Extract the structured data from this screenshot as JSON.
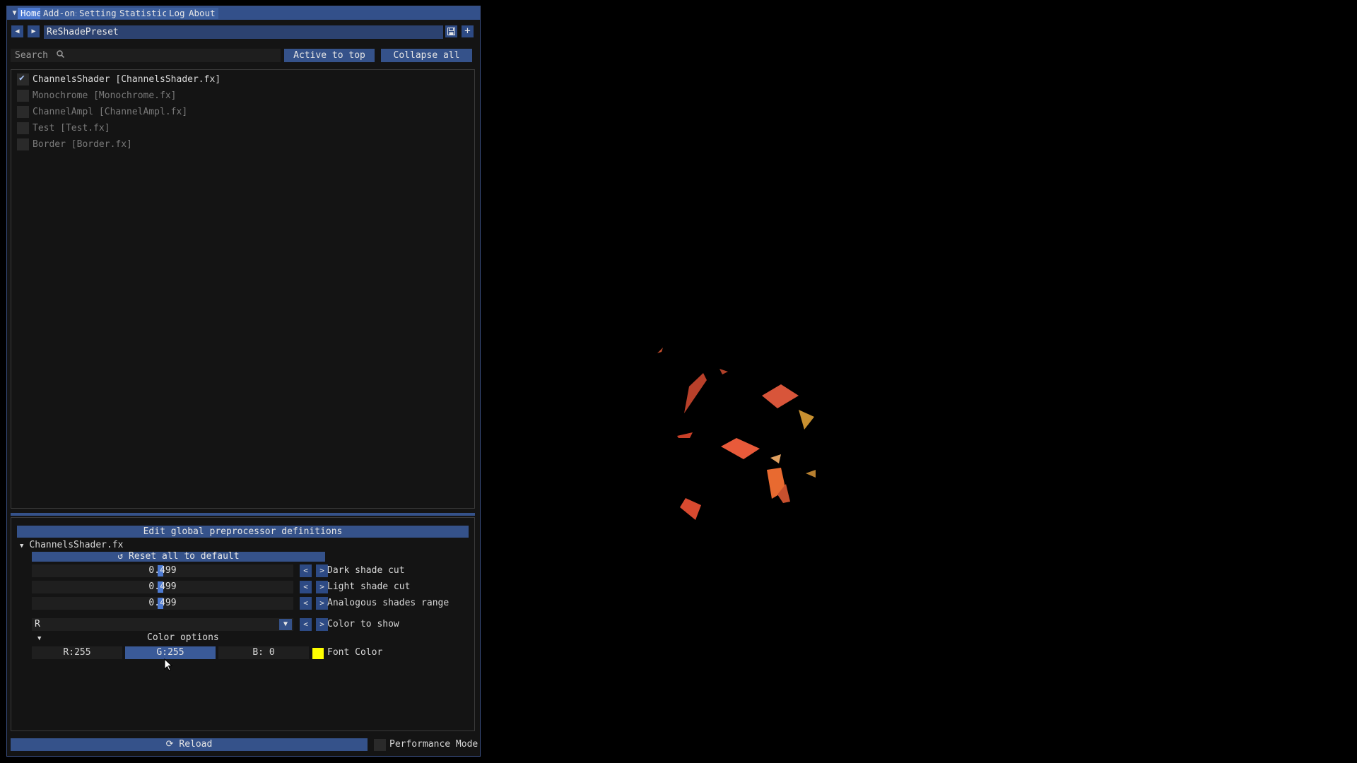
{
  "titlebar": {
    "menu_icon": "caret-down-icon",
    "tabs": [
      {
        "label": "Home",
        "active": true
      },
      {
        "label": "Add-ons",
        "active": false
      },
      {
        "label": "Settings",
        "active": false
      },
      {
        "label": "Statistics",
        "active": false
      },
      {
        "label": "Log",
        "active": false
      },
      {
        "label": "About",
        "active": false
      }
    ]
  },
  "preset": {
    "name": "ReShadePreset",
    "prev_icon": "triangle-left-icon",
    "next_icon": "triangle-right-icon",
    "save_icon": "save-icon",
    "add_icon": "plus-icon"
  },
  "search": {
    "placeholder": "Search",
    "icon": "search-icon",
    "active_to_top": "Active to top",
    "collapse_all": "Collapse all"
  },
  "effects": [
    {
      "label": "ChannelsShader [ChannelsShader.fx]",
      "enabled": true
    },
    {
      "label": "Monochrome [Monochrome.fx]",
      "enabled": false
    },
    {
      "label": "ChannelAmpl [ChannelAmpl.fx]",
      "enabled": false
    },
    {
      "label": "Test [Test.fx]",
      "enabled": false
    },
    {
      "label": "Border [Border.fx]",
      "enabled": false
    }
  ],
  "params": {
    "edit_global": "Edit global preprocessor definitions",
    "shader_file": "ChannelsShader.fx",
    "reset_label": "Reset all to default",
    "reset_icon": "undo-icon",
    "sliders": [
      {
        "value": "0.499",
        "label": "Dark shade cut"
      },
      {
        "value": "0.499",
        "label": "Light shade cut"
      },
      {
        "value": "0.499",
        "label": "Analogous shades range"
      }
    ],
    "prev_label": "<",
    "next_label": ">",
    "combo": {
      "value": "R",
      "label": "Color to show"
    },
    "color_options_title": "Color options",
    "color": {
      "r": "R:255",
      "g": "G:255",
      "b": "B:  0",
      "label": "Font Color",
      "swatch": "#ffff00"
    }
  },
  "footer": {
    "reload_label": "Reload",
    "reload_icon": "refresh-icon",
    "performance_mode": "Performance Mode",
    "performance_enabled": false
  },
  "colors": {
    "accent": "#35528a",
    "active_tab": "#4d7ad1",
    "panel_bg": "#141414"
  }
}
